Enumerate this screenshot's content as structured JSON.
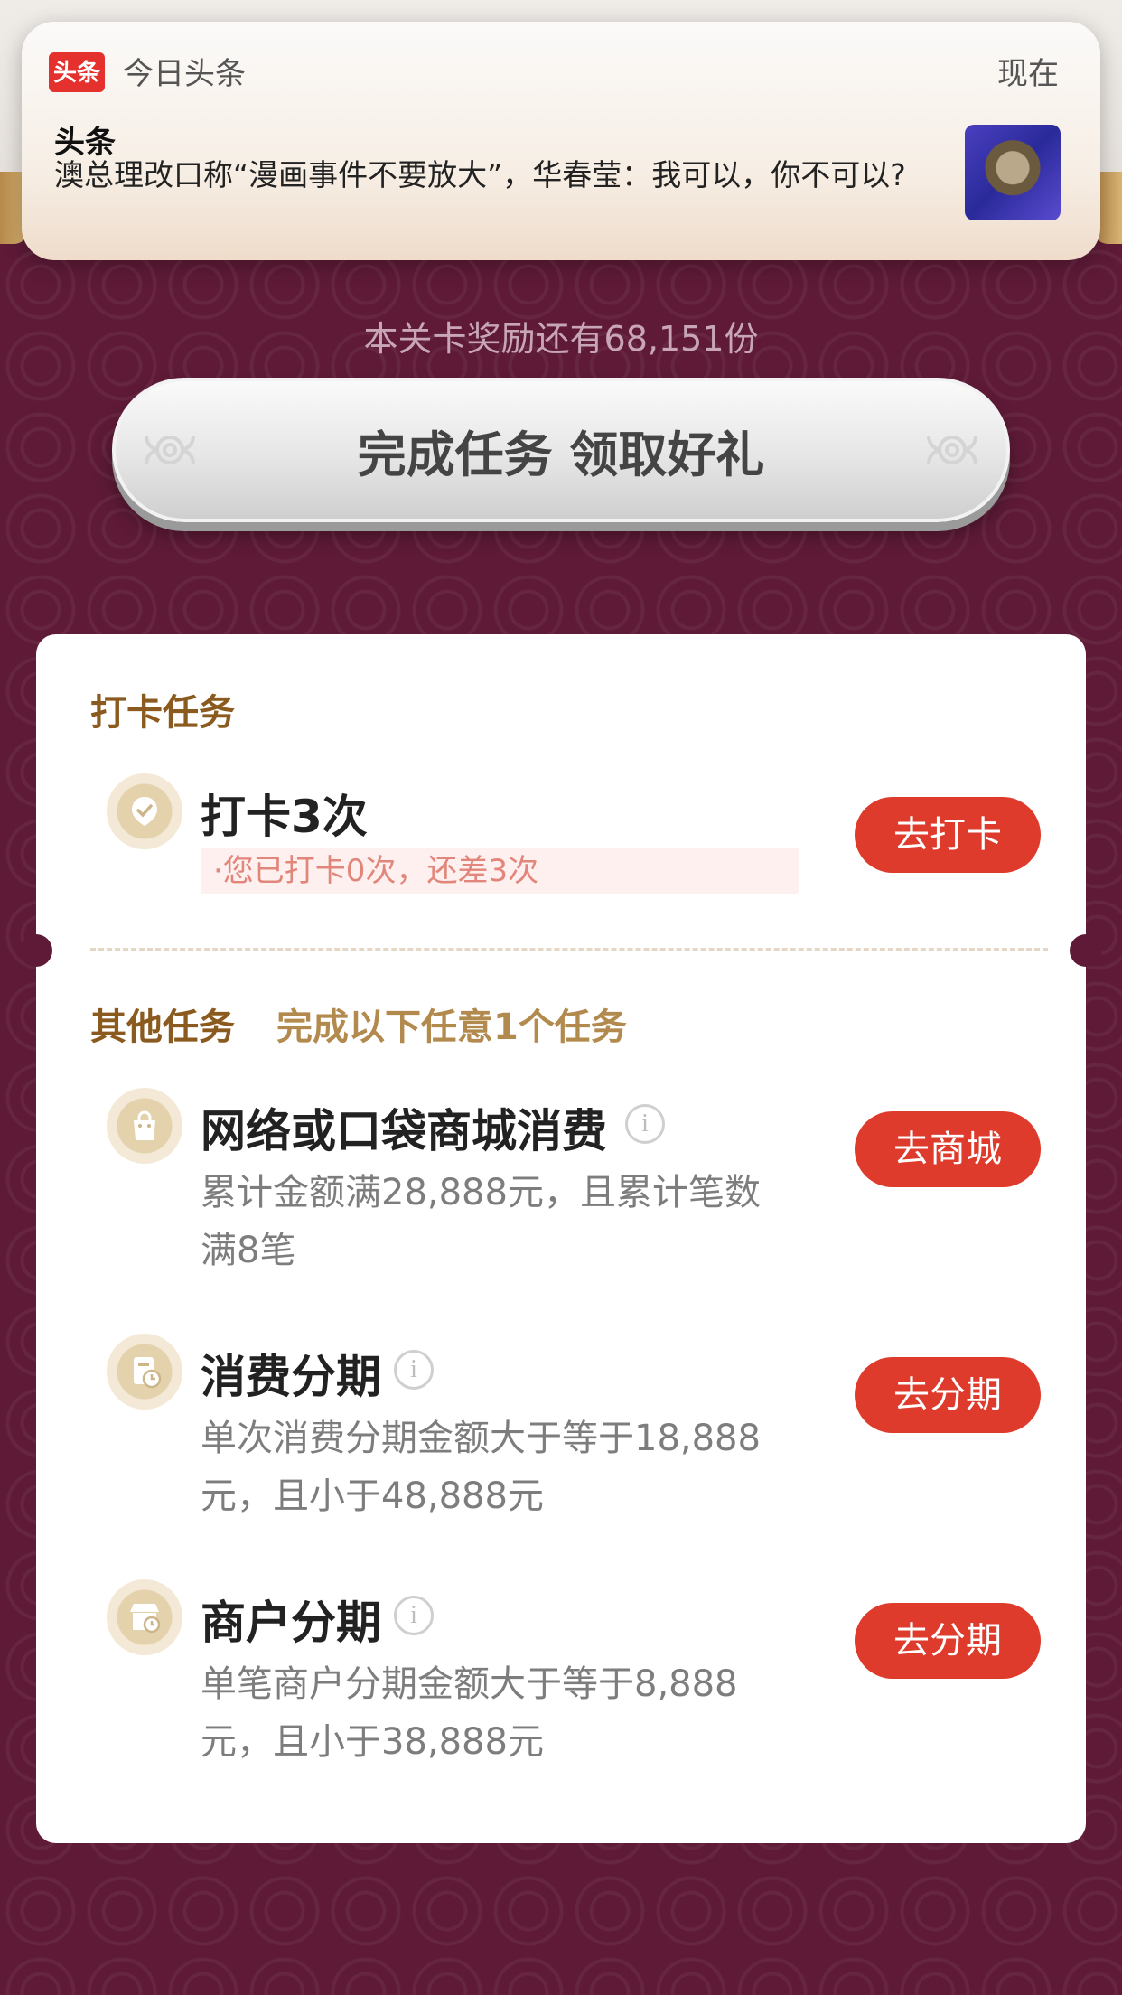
{
  "notification": {
    "app_icon_text": "头条",
    "app_name": "今日头条",
    "time": "现在",
    "title": "头条",
    "body": "澳总理改口称“漫画事件不要放大”，华春莹：我可以，你不可以?"
  },
  "reward": {
    "remaining_text": "本关卡奖励还有68,151份"
  },
  "cta": {
    "label": "完成任务 领取好礼"
  },
  "checkin_section": {
    "title": "打卡任务",
    "task": {
      "title": "打卡3次",
      "progress": "·您已打卡0次，还差3次",
      "button": "去打卡"
    }
  },
  "other_section": {
    "title": "其他任务",
    "subtitle": "完成以下任意1个任务",
    "tasks": [
      {
        "title": "网络或口袋商城消费",
        "desc_line1": "累计金额满28,888元，且累计笔数",
        "desc_line2": "满8笔",
        "button": "去商城",
        "icon": "shopping-bag-icon"
      },
      {
        "title": "消费分期",
        "desc_line1": "单次消费分期金额大于等于18,888",
        "desc_line2": "元，且小于48,888元",
        "button": "去分期",
        "icon": "installment-bill-icon"
      },
      {
        "title": "商户分期",
        "desc_line1": "单笔商户分期金额大于等于8,888",
        "desc_line2": "元，且小于38,888元",
        "button": "去分期",
        "icon": "merchant-store-icon"
      }
    ]
  },
  "colors": {
    "background": "#5e1a37",
    "accent_red": "#de3b2c",
    "section_gold": "#8b5a1e"
  }
}
